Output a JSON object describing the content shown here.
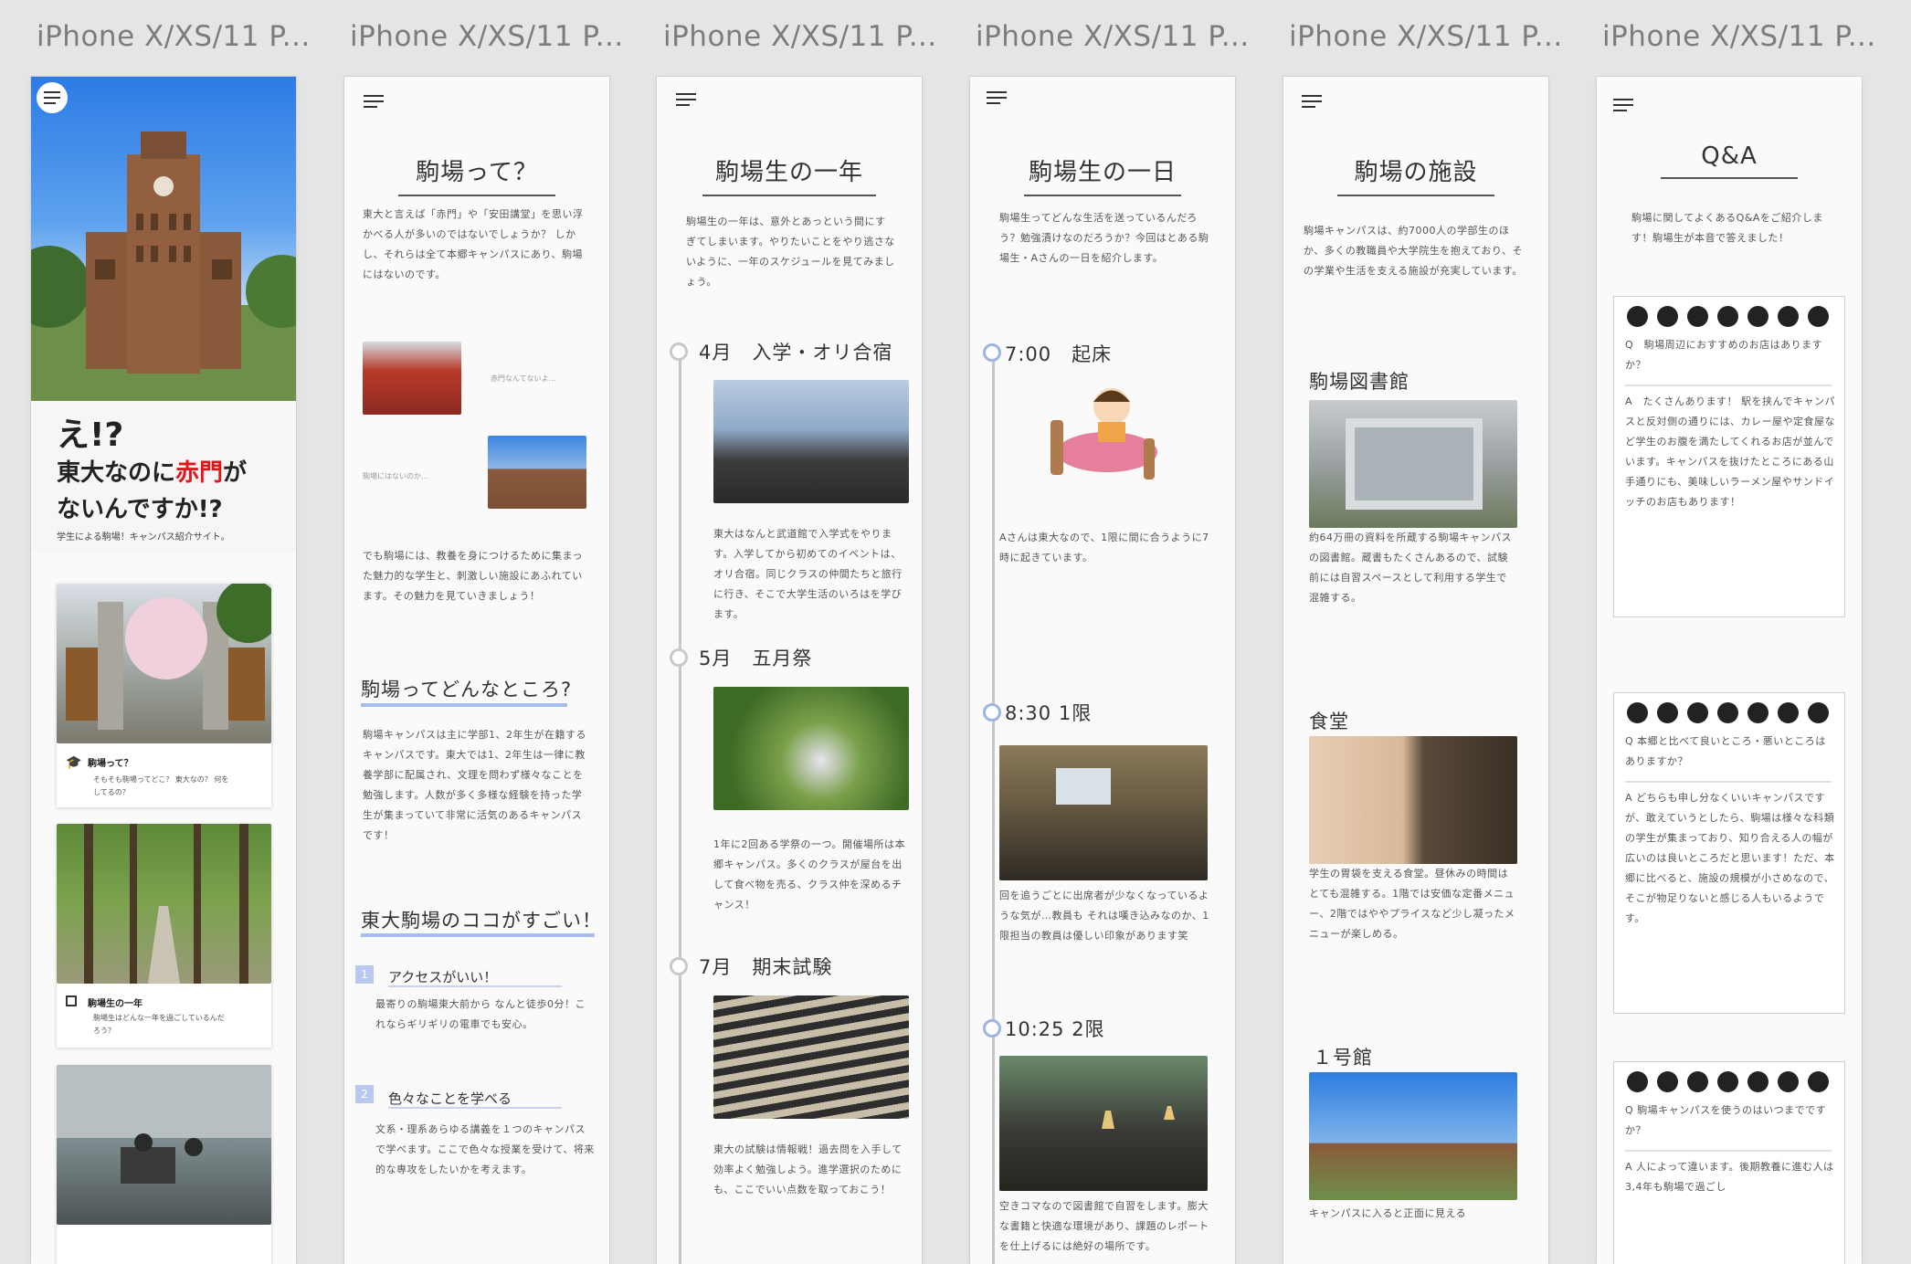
{
  "artboards": [
    {
      "title": "iPhone X/XS/11 P..."
    },
    {
      "title": "iPhone X/XS/11 P..."
    },
    {
      "title": "iPhone X/XS/11 P..."
    },
    {
      "title": "iPhone X/XS/11 P..."
    },
    {
      "title": "iPhone X/XS/11 P..."
    },
    {
      "title": "iPhone X/XS/11 P..."
    }
  ],
  "home": {
    "hero_line1": "え!?",
    "hero_line2_a": "東大なのに",
    "hero_line2_red": "赤門",
    "hero_line2_b": "が",
    "hero_line3": "ないんですか!?",
    "tagline": "学生による駒場！キャンパス紹介サイト。",
    "cards": [
      {
        "title": "駒場って？",
        "desc": "そもそも駒場ってどこ？ 東大なの？ 何をしてるの？"
      },
      {
        "title": "駒場生の一年",
        "desc": "駒場生はどんな一年を過ごしているんだろう？"
      }
    ]
  },
  "about": {
    "heading": "駒場って？",
    "intro": "東大と言えば「赤門」や「安田講堂」を思い浮かべる人が多いのではないでしょうか？ しかし、それらは全て本郷キャンパスにあり、駒場にはないのです。",
    "caption1": "赤門なんてないよ…",
    "caption2": "駒場にはないのか…",
    "body": "でも駒場には、教養を身につけるために集まった魅力的な学生と、刺激しい施設にあふれています。その魅力を見ていきましょう！",
    "sec1": "駒場ってどんなところ?",
    "sec1_body": "駒場キャンパスは主に学部1、2年生が在籍するキャンパスです。東大では1、2年生は一律に教養学部に配属され、文理を問わず様々なことを勉強します。人数が多く多様な経験を持った学生が集まっていて非常に活気のあるキャンパスです！",
    "sec2": "東大駒場のココがすごい！",
    "points": [
      {
        "num": "1",
        "title": "アクセスがいい！",
        "body": "最寄りの駒場東大前から なんと徒歩0分！これならギリギリの電車でも安心。"
      },
      {
        "num": "2",
        "title": "色々なことを学べる",
        "body": "文系・理系あらゆる講義を１つのキャンパスで学べます。ここで色々な授業を受けて、将来的な専攻をしたいかを考えます。"
      }
    ]
  },
  "year": {
    "heading": "駒場生の一年",
    "intro": "駒場生の一年は、意外とあっという間にすぎてしまいます。やりたいことをやり逃さないように、一年のスケジュールを見てみましょう。",
    "events": [
      {
        "label": "4月　入学・オリ合宿",
        "body": "東大はなんと武道館で入学式をやります。入学してから初めてのイベントは、オリ合宿。同じクラスの仲間たちと旅行に行き、そこで大学生活のいろはを学びます。"
      },
      {
        "label": "5月　五月祭",
        "body": "1年に2回ある学祭の一つ。開催場所は本郷キャンパス。多くのクラスが屋台を出して食べ物を売る、クラス仲を深めるチャンス！"
      },
      {
        "label": "7月　期末試験",
        "body": "東大の試験は情報戦！過去問を入手して効率よく勉強しよう。進学選択のためにも、ここでいい点数を取っておこう！"
      }
    ]
  },
  "day": {
    "heading": "駒場生の一日",
    "intro": "駒場生ってどんな生活を送っているんだろう？勉強漬けなのだろうか？今回はとある駒場生・Aさんの一日を紹介します。",
    "events": [
      {
        "label": "7:00　起床",
        "body": "Aさんは東大なので、1限に間に合うように7時に起きています。"
      },
      {
        "label": "8:30 1限",
        "body": "回を追うごとに出席者が少なくなっているような気が…教員も それは嘆き込みなのか、1限担当の教員は優しい印象があります笑"
      },
      {
        "label": "10:25 2限",
        "body": "空きコマなので図書館で自習をします。膨大な書籍と快適な環境があり、課題のレポートを仕上げるには絶好の場所です。"
      }
    ]
  },
  "facilities": {
    "heading": "駒場の施設",
    "intro": "駒場キャンパスは、約7000人の学部生のほか、多くの教職員や大学院生を抱えており、その学業や生活を支える施設が充実しています。",
    "items": [
      {
        "name": "駒場図書館",
        "body": "約64万冊の資料を所蔵する駒場キャンパスの図書館。蔵書もたくさんあるので、試験前には自習スペースとして利用する学生で混雑する。"
      },
      {
        "name": "食堂",
        "body": "学生の胃袋を支える食堂。昼休みの時間はとても混雑する。1階では安価な定番メニュー、2階ではややプライスなど少し凝ったメニューが楽しめる。"
      },
      {
        "name": "１号館",
        "body": "キャンパスに入ると正面に見える"
      }
    ]
  },
  "qa": {
    "heading": "Q&A",
    "intro": "駒場に関してよくあるQ&Aをご紹介します！駒場生が本音で答えました！",
    "items": [
      {
        "q": "Q　駒場周辺におすすめのお店はありますか？",
        "a": "A　たくさんあります！ 駅を挟んでキャンパスと反対側の通りには、カレー屋や定食屋など学生のお腹を満たしてくれるお店が並んでいます。キャンパスを抜けたところにある山手通りにも、美味しいラーメン屋やサンドイッチのお店もあります！"
      },
      {
        "q": "Q 本郷と比べて良いところ・悪いところはありますか？",
        "a": "A どちらも申し分なくいいキャンパスですが、敢えていうとしたら、駒場は様々な科類の学生が集まっており、知り合える人の幅が広いのは良いところだと思います！ただ、本郷に比べると、施設の規模が小さめなので、そこが物足りないと感じる人もいるようです。"
      },
      {
        "q": "Q 駒場キャンパスを使うのはいつまでですか？",
        "a": "A 人によって違います。後期教養に進む人は3,4年も駒場で過ごし"
      }
    ]
  }
}
